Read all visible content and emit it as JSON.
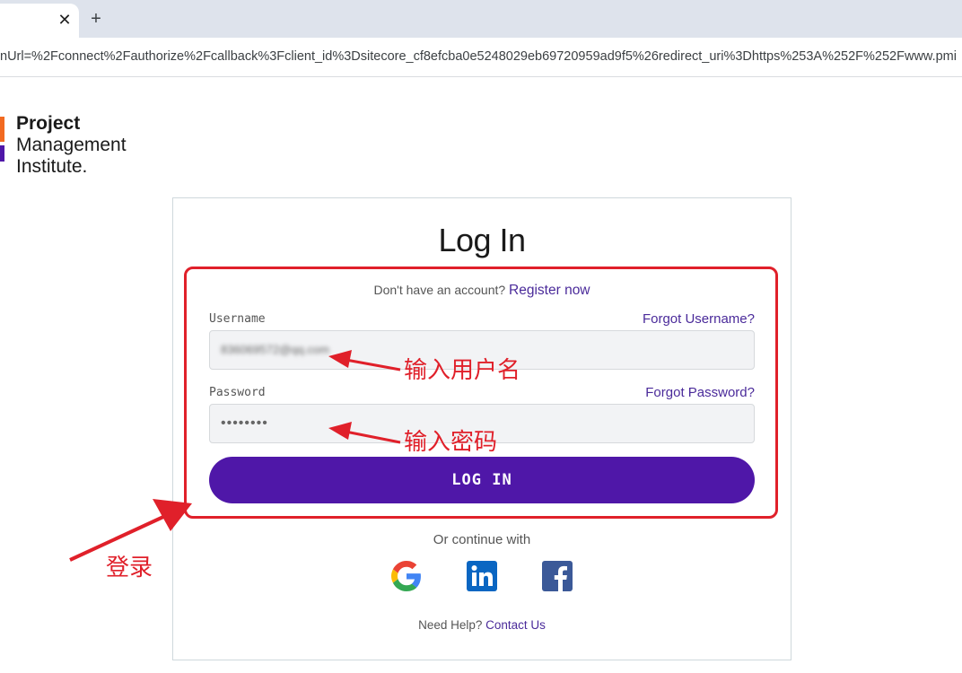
{
  "browser": {
    "tab_close_glyph": "✕",
    "new_tab_glyph": "+",
    "url": "nUrl=%2Fconnect%2Fauthorize%2Fcallback%3Fclient_id%3Dsitecore_cf8efcba0e5248029eb69720959ad9f5%26redirect_uri%3Dhttps%253A%252F%252Fwww.pmi"
  },
  "logo": {
    "line1": "Project",
    "line2": "Management",
    "line3": "Institute.",
    "colors": {
      "orange": "#f26a21",
      "purple": "#4f17a8"
    }
  },
  "login": {
    "title": "Log In",
    "register_prompt": "Don't have an account?",
    "register_link": "Register now",
    "username_label": "Username",
    "forgot_username": "Forgot Username?",
    "username_value": "836069572@qq.com",
    "password_label": "Password",
    "forgot_password": "Forgot Password?",
    "password_value": "••••••••",
    "login_button": "LOG IN",
    "continue_with": "Or continue with",
    "social": [
      "google-icon",
      "linkedin-icon",
      "facebook-icon"
    ],
    "help_prompt": "Need Help?",
    "help_link": "Contact Us",
    "accent_color": "#4f17a8"
  },
  "annotations": {
    "username_hint": "输入用户名",
    "password_hint": "输入密码",
    "login_hint": "登录",
    "color": "#e0202a"
  }
}
